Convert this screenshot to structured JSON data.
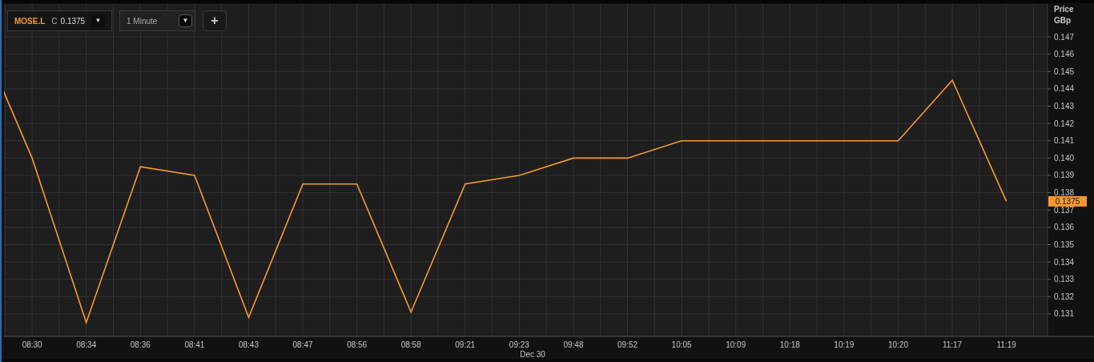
{
  "toolbar": {
    "symbol": {
      "ticker": "MOSE.L",
      "close_label": "C",
      "close_value": "0.1375",
      "caret": "▼"
    },
    "interval": {
      "value": "1 Minute",
      "caret": "▼"
    },
    "add_button": "+"
  },
  "chart": {
    "axis_title": [
      "Price",
      "GBp"
    ],
    "last_price": "0.1375",
    "date_label": "Dec 30",
    "chart_data": {
      "type": "line",
      "categories": [
        null,
        "08:30",
        "08:34",
        "08:36",
        "08:41",
        "08:43",
        "08:47",
        "08:56",
        "08:58",
        "09:21",
        "09:23",
        "09:48",
        "09:52",
        "10:05",
        "10:09",
        "10:18",
        "10:19",
        "10:20",
        "11:17",
        "11:19"
      ],
      "series": [
        {
          "color": "#f7992e",
          "values": [
            0.1473,
            0.14,
            0.1305,
            0.1395,
            0.139,
            0.1308,
            0.1385,
            0.1385,
            0.1311,
            0.1385,
            0.139,
            0.14,
            0.14,
            0.141,
            0.141,
            0.141,
            0.141,
            0.141,
            0.1445,
            0.1375
          ]
        }
      ],
      "grid": true,
      "ylim": [
        0.1297,
        0.1489
      ],
      "yticks": [
        0.131,
        0.132,
        0.133,
        0.134,
        0.135,
        0.136,
        0.137,
        0.138,
        0.139,
        {
          "value": 0.14,
          "label": "0.140"
        },
        0.141,
        0.142,
        0.143,
        0.144,
        0.145,
        0.146,
        0.147
      ]
    }
  }
}
